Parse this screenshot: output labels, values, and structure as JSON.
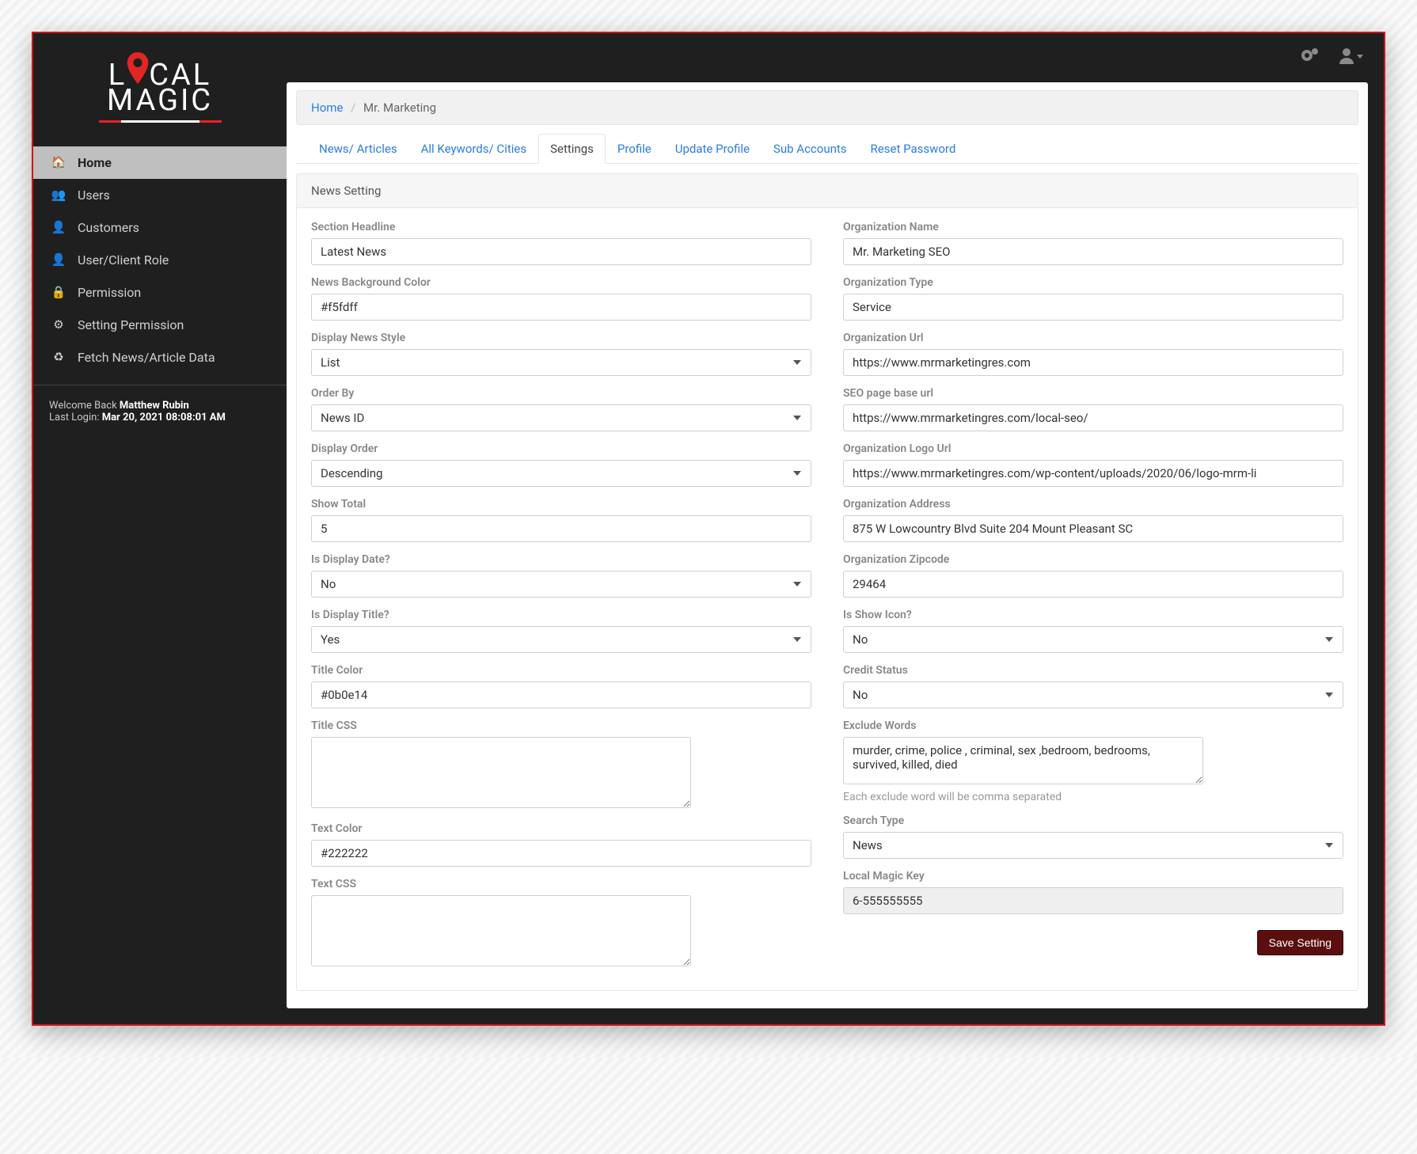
{
  "logo": {
    "line1_a": "L",
    "line1_b": "CAL",
    "line2": "MAGIC"
  },
  "topbar": {
    "gears_name": "settings-icon",
    "user_name": "user-menu-icon"
  },
  "sidebar": {
    "items": [
      {
        "id": "home",
        "label": "Home",
        "icon": "🏠",
        "active": true
      },
      {
        "id": "users",
        "label": "Users",
        "icon": "👥",
        "active": false
      },
      {
        "id": "customers",
        "label": "Customers",
        "icon": "👤",
        "active": false
      },
      {
        "id": "user-client-role",
        "label": "User/Client Role",
        "icon": "👤",
        "active": false
      },
      {
        "id": "permission",
        "label": "Permission",
        "icon": "🔒",
        "active": false
      },
      {
        "id": "setting-permission",
        "label": "Setting Permission",
        "icon": "⚙",
        "active": false
      },
      {
        "id": "fetch-news",
        "label": "Fetch News/Article Data",
        "icon": "♻",
        "active": false
      }
    ]
  },
  "welcome": {
    "welcome_prefix": "Welcome Back ",
    "user_name": "Matthew Rubin",
    "last_login_prefix": "Last Login: ",
    "last_login": "Mar 20, 2021 08:08:01 AM"
  },
  "breadcrumb": {
    "home": "Home",
    "current": "Mr. Marketing"
  },
  "tabs": [
    {
      "id": "news-articles",
      "label": "News/ Articles",
      "active": false
    },
    {
      "id": "all-keywords-cities",
      "label": "All Keywords/ Cities",
      "active": false
    },
    {
      "id": "settings",
      "label": "Settings",
      "active": true
    },
    {
      "id": "profile",
      "label": "Profile",
      "active": false
    },
    {
      "id": "update-profile",
      "label": "Update Profile",
      "active": false
    },
    {
      "id": "sub-accounts",
      "label": "Sub Accounts",
      "active": false
    },
    {
      "id": "reset-password",
      "label": "Reset Password",
      "active": false
    }
  ],
  "panel": {
    "title": "News Setting"
  },
  "form": {
    "left": {
      "section_headline": {
        "label": "Section Headline",
        "value": "Latest News"
      },
      "news_background_color": {
        "label": "News Background Color",
        "value": "#f5fdff"
      },
      "display_news_style": {
        "label": "Display News Style",
        "value": "List"
      },
      "order_by": {
        "label": "Order By",
        "value": "News ID"
      },
      "display_order": {
        "label": "Display Order",
        "value": "Descending"
      },
      "show_total": {
        "label": "Show Total",
        "value": "5"
      },
      "is_display_date": {
        "label": "Is Display Date?",
        "value": "No"
      },
      "is_display_title": {
        "label": "Is Display Title?",
        "value": "Yes"
      },
      "title_color": {
        "label": "Title Color",
        "value": "#0b0e14"
      },
      "title_css": {
        "label": "Title CSS",
        "value": ""
      },
      "text_color": {
        "label": "Text Color",
        "value": "#222222"
      },
      "text_css": {
        "label": "Text CSS",
        "value": ""
      }
    },
    "right": {
      "organization_name": {
        "label": "Organization Name",
        "value": "Mr. Marketing SEO"
      },
      "organization_type": {
        "label": "Organization Type",
        "value": "Service"
      },
      "organization_url": {
        "label": "Organization Url",
        "value": "https://www.mrmarketingres.com"
      },
      "seo_page_base_url": {
        "label": "SEO page base url",
        "value": "https://www.mrmarketingres.com/local-seo/"
      },
      "organization_logo_url": {
        "label": "Organization Logo Url",
        "value": "https://www.mrmarketingres.com/wp-content/uploads/2020/06/logo-mrm-li"
      },
      "organization_address": {
        "label": "Organization Address",
        "value": "875 W Lowcountry Blvd Suite 204 Mount Pleasant SC"
      },
      "organization_zipcode": {
        "label": "Organization Zipcode",
        "value": "29464"
      },
      "is_show_icon": {
        "label": "Is Show Icon?",
        "value": "No"
      },
      "credit_status": {
        "label": "Credit Status",
        "value": "No"
      },
      "exclude_words": {
        "label": "Exclude Words",
        "value": "murder, crime, police , criminal, sex ,bedroom, bedrooms, survived, killed, died",
        "help": "Each exclude word will be comma separated"
      },
      "search_type": {
        "label": "Search Type",
        "value": "News"
      },
      "local_magic_key": {
        "label": "Local Magic Key",
        "value": "6-555555555"
      }
    }
  },
  "buttons": {
    "save": "Save Setting"
  }
}
